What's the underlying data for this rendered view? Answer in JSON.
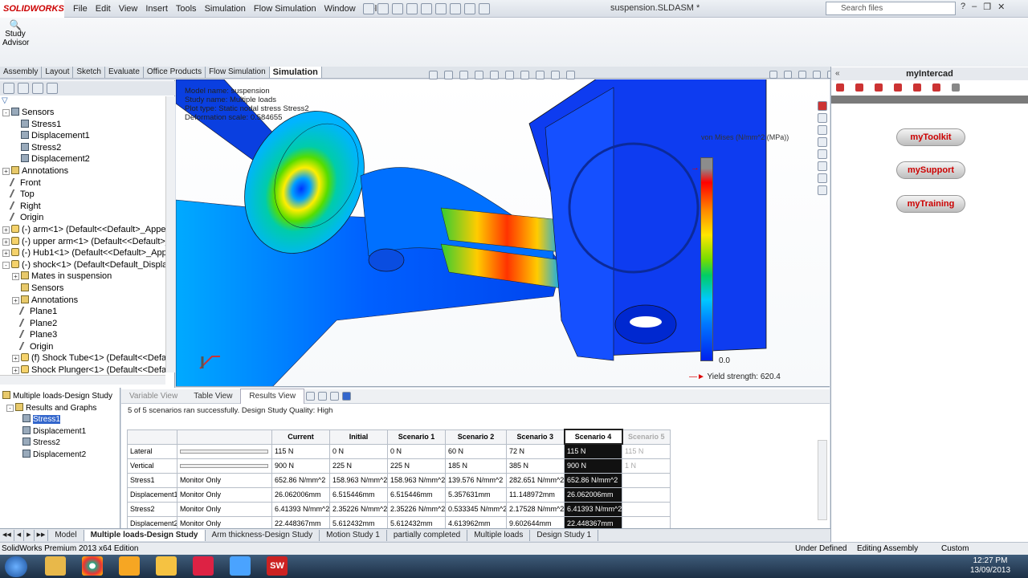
{
  "app": {
    "logo_text": "SOLIDWORKS",
    "document_title": "suspension.SLDASM *",
    "search_placeholder": "Search files"
  },
  "menu": [
    "File",
    "Edit",
    "View",
    "Insert",
    "Tools",
    "Simulation",
    "Flow Simulation",
    "Window",
    "Help"
  ],
  "command_bar": {
    "study_advisor": "Study Advisor"
  },
  "command_tabs": [
    "Assembly",
    "Layout",
    "Sketch",
    "Evaluate",
    "Office Products",
    "Flow Simulation",
    "Simulation"
  ],
  "active_command_tab": "Simulation",
  "feature_tree": [
    {
      "label": "Sensors",
      "indent": 0,
      "icon": "sens",
      "exp": "-"
    },
    {
      "label": "Stress1",
      "indent": 1,
      "icon": "sens"
    },
    {
      "label": "Displacement1",
      "indent": 1,
      "icon": "sens"
    },
    {
      "label": "Stress2",
      "indent": 1,
      "icon": "sens"
    },
    {
      "label": "Displacement2",
      "indent": 1,
      "icon": "sens"
    },
    {
      "label": "Annotations",
      "indent": 0,
      "icon": "ico",
      "exp": "+"
    },
    {
      "label": "Front",
      "indent": 0,
      "icon": "plane"
    },
    {
      "label": "Top",
      "indent": 0,
      "icon": "plane"
    },
    {
      "label": "Right",
      "indent": 0,
      "icon": "plane"
    },
    {
      "label": "Origin",
      "indent": 0,
      "icon": "plane"
    },
    {
      "label": "(-) arm<1> (Default<<Default>_Appear",
      "indent": 0,
      "icon": "part",
      "exp": "+"
    },
    {
      "label": "(-) upper arm<1> (Default<<Default>_A",
      "indent": 0,
      "icon": "part",
      "exp": "+"
    },
    {
      "label": "(-) Hub1<1> (Default<<Default>_Appea",
      "indent": 0,
      "icon": "part",
      "exp": "+"
    },
    {
      "label": "(-) shock<1> (Default<Default_Display S",
      "indent": 0,
      "icon": "part",
      "exp": "-"
    },
    {
      "label": "Mates in suspension",
      "indent": 1,
      "icon": "ico",
      "exp": "+"
    },
    {
      "label": "Sensors",
      "indent": 1,
      "icon": "ico"
    },
    {
      "label": "Annotations",
      "indent": 1,
      "icon": "ico",
      "exp": "+"
    },
    {
      "label": "Plane1",
      "indent": 1,
      "icon": "plane"
    },
    {
      "label": "Plane2",
      "indent": 1,
      "icon": "plane"
    },
    {
      "label": "Plane3",
      "indent": 1,
      "icon": "plane"
    },
    {
      "label": "Origin",
      "indent": 1,
      "icon": "plane"
    },
    {
      "label": "(f) Shock Tube<1> (Default<<Default",
      "indent": 1,
      "icon": "part",
      "exp": "+"
    },
    {
      "label": "Shock Plunger<1> (Default<<Default",
      "indent": 1,
      "icon": "part",
      "exp": "+"
    }
  ],
  "viewport": {
    "info_lines": [
      "Model name: suspension",
      "Study name: Multiple loads",
      "Plot type: Static nodal stress Stress2",
      "Deformation scale: 0.584655"
    ],
    "legend_title": "von Mises (N/mm^2 (MPa))",
    "legend_min": "0.0",
    "yield_strength": "Yield strength: 620.4"
  },
  "task_pane": {
    "title": "myIntercad",
    "buttons": [
      "myToolkit",
      "mySupport",
      "myTraining"
    ]
  },
  "design_study": {
    "tree": {
      "root": "Multiple loads-Design Study",
      "results": "Results and Graphs",
      "items": [
        "Stress1",
        "Displacement1",
        "Stress2",
        "Displacement2"
      ],
      "selected": "Stress1"
    },
    "view_tabs": [
      "Variable View",
      "Table View",
      "Results View"
    ],
    "message": "5 of 5 scenarios ran successfully. Design Study Quality: High",
    "columns": [
      "",
      "",
      "Current",
      "Initial",
      "Scenario 1",
      "Scenario 2",
      "Scenario 3",
      "Scenario 4",
      "Scenario 5"
    ],
    "rows": [
      [
        "Lateral",
        "",
        "115 N",
        "0 N",
        "0 N",
        "60 N",
        "72 N",
        "115 N",
        "115 N"
      ],
      [
        "Vertical",
        "",
        "900 N",
        "225 N",
        "225 N",
        "185 N",
        "385 N",
        "900 N",
        "1 N"
      ],
      [
        "Stress1",
        "Monitor Only",
        "652.86 N/mm^2",
        "158.963 N/mm^2",
        "158.963 N/mm^2",
        "139.576 N/mm^2",
        "282.651 N/mm^2",
        "652.86 N/mm^2",
        ""
      ],
      [
        "Displacement1",
        "Monitor Only",
        "26.062006mm",
        "6.515446mm",
        "6.515446mm",
        "5.357631mm",
        "11.148972mm",
        "26.062006mm",
        ""
      ],
      [
        "Stress2",
        "Monitor Only",
        "6.41393 N/mm^2",
        "2.35226 N/mm^2",
        "2.35226 N/mm^2",
        "0.533345 N/mm^2",
        "2.17528 N/mm^2",
        "6.41393 N/mm^2",
        ""
      ],
      [
        "Displacement2",
        "Monitor Only",
        "22.448367mm",
        "5.612432mm",
        "5.612432mm",
        "4.613962mm",
        "9.602644mm",
        "22.448367mm",
        ""
      ]
    ]
  },
  "bottom_tabs": [
    "Model",
    "Multiple loads-Design Study",
    "Arm thickness-Design Study",
    "Motion Study 1",
    "partially completed",
    "Multiple loads",
    "Design Study 1"
  ],
  "status": {
    "left": "SolidWorks Premium 2013 x64 Edition",
    "state": "Under Defined",
    "mode": "Editing Assembly",
    "units": "Custom"
  },
  "clock": {
    "time": "12:27 PM",
    "date": "13/09/2013"
  }
}
